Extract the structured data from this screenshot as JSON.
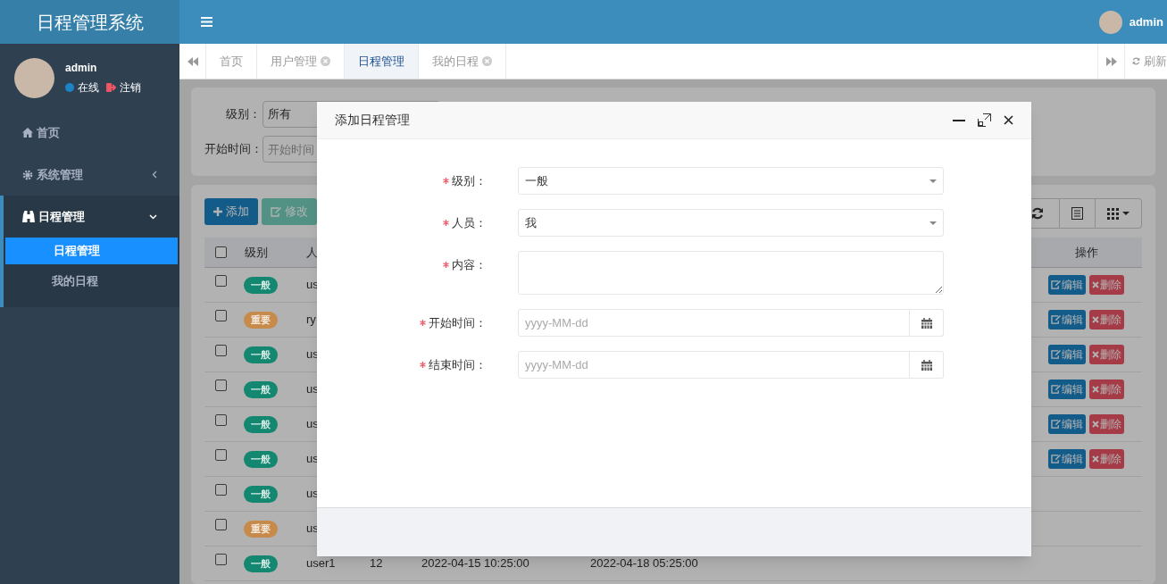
{
  "app_title": "日程管理系统",
  "user": {
    "name": "admin",
    "status": "在线",
    "logout": "注销"
  },
  "header_user": "admin",
  "sidebar": {
    "items": [
      {
        "kind": "link",
        "label": "首页"
      },
      {
        "kind": "group",
        "label": "系统管理",
        "expanded": false
      },
      {
        "kind": "group",
        "label": "日程管理",
        "expanded": true,
        "children": [
          {
            "label": "日程管理",
            "selected": true
          },
          {
            "label": "我的日程",
            "selected": false
          }
        ]
      }
    ]
  },
  "tabs": [
    {
      "label": "首页",
      "closable": false,
      "selected": false
    },
    {
      "label": "用户管理",
      "closable": true,
      "selected": false
    },
    {
      "label": "日程管理",
      "closable": false,
      "selected": true
    },
    {
      "label": "我的日程",
      "closable": true,
      "selected": false
    }
  ],
  "refresh": "刷新",
  "search": {
    "fields": [
      {
        "label": "级别：",
        "value": "所有"
      },
      {
        "label": "开始时间：",
        "placeholder": "开始时间"
      }
    ]
  },
  "toolbar": {
    "buttons": [
      {
        "label": "添加",
        "disabled": false
      },
      {
        "label": "修改",
        "disabled": true
      }
    ]
  },
  "table": {
    "header_checked": false,
    "level_column": "级别",
    "columns": [
      "人"
    ],
    "actions_column": "操作",
    "rows": [
      {
        "checked": false,
        "level": "一般",
        "color": "#13876f",
        "cells": [
          "us"
        ],
        "actions": [
          "编辑",
          "删除"
        ]
      },
      {
        "checked": false,
        "level": "重要",
        "color": "#c68b4a",
        "cells": [
          "ry"
        ],
        "actions": [
          "编辑",
          "删除"
        ]
      },
      {
        "checked": false,
        "level": "一般",
        "color": "#13876f",
        "cells": [
          "us"
        ],
        "actions": [
          "编辑",
          "删除"
        ]
      },
      {
        "checked": false,
        "level": "一般",
        "color": "#13876f",
        "cells": [
          "us"
        ],
        "actions": [
          "编辑",
          "删除"
        ]
      },
      {
        "checked": false,
        "level": "一般",
        "color": "#13876f",
        "cells": [
          "us"
        ],
        "actions": [
          "编辑",
          "删除"
        ]
      },
      {
        "checked": false,
        "level": "一般",
        "color": "#13876f",
        "cells": [
          "us"
        ],
        "actions": [
          "编辑",
          "删除"
        ]
      },
      {
        "checked": false,
        "level": "一般",
        "color": "#13876f",
        "cells": [
          "us"
        ],
        "actions": []
      },
      {
        "checked": false,
        "level": "重要",
        "color": "#c68b4a",
        "cells": [
          "us"
        ],
        "actions": []
      },
      {
        "checked": false,
        "level": "一般",
        "color": "#13876f",
        "cells": [
          "user1",
          "12",
          "2022-04-15 10:25:00",
          "2022-04-18 05:25:00"
        ],
        "actions": []
      }
    ]
  },
  "modal": {
    "title": "添加日程管理",
    "fields": [
      {
        "kind": "select",
        "label": "级别：",
        "required": true,
        "value": "一般"
      },
      {
        "kind": "select",
        "label": "人员：",
        "required": true,
        "value": "我"
      },
      {
        "kind": "textarea",
        "label": "内容：",
        "required": true
      },
      {
        "kind": "date",
        "label": "开始时间：",
        "required": true,
        "placeholder": "yyyy-MM-dd"
      },
      {
        "kind": "date",
        "label": "结束时间：",
        "required": true,
        "placeholder": "yyyy-MM-dd"
      }
    ]
  }
}
